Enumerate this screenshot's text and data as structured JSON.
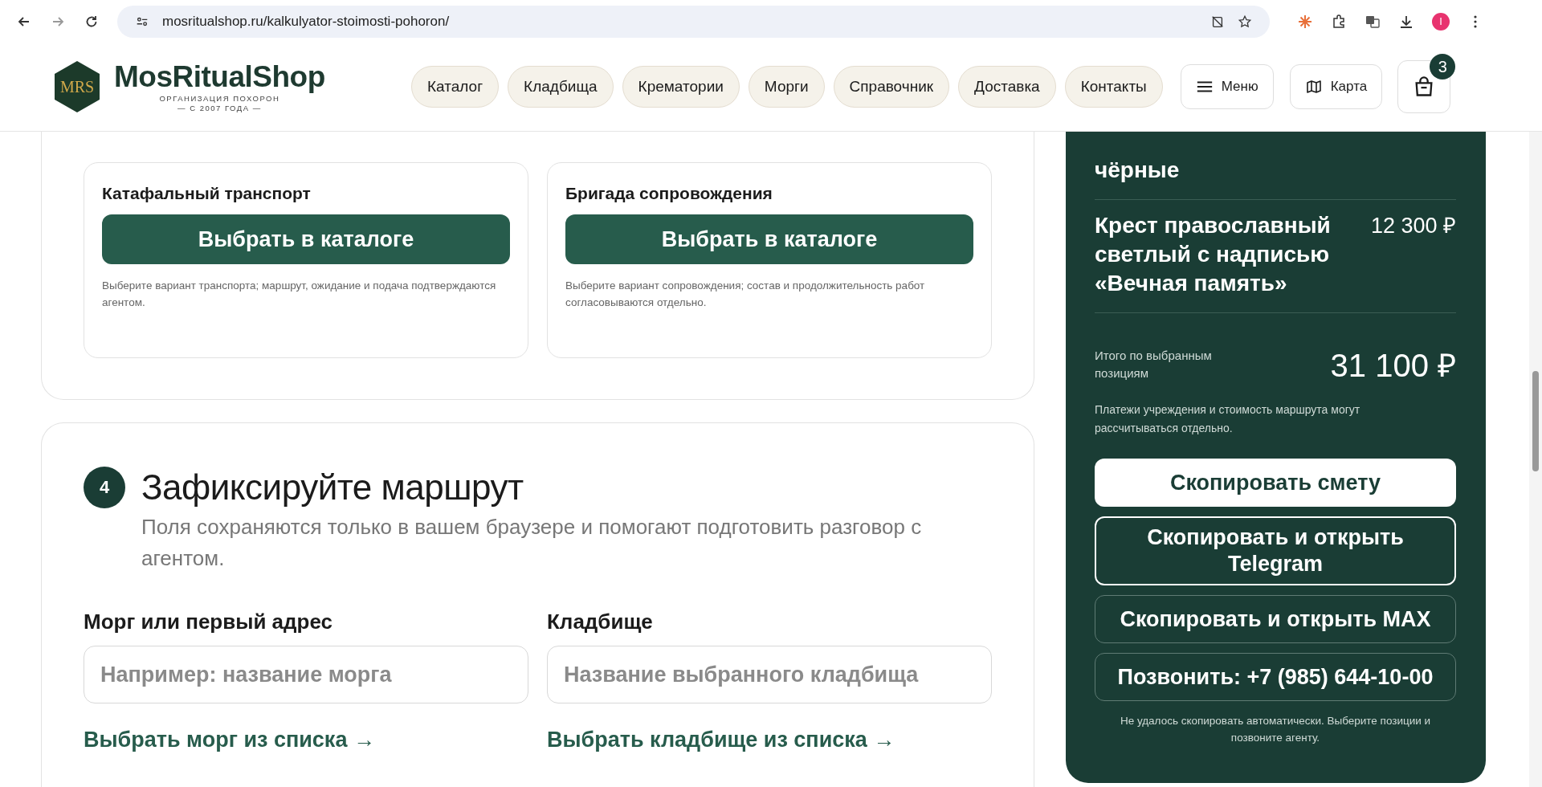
{
  "browser": {
    "url": "mosritualshop.ru/kalkulyator-stoimosti-pohoron/",
    "profile_initial": "I"
  },
  "header": {
    "logo_letters": "MRS",
    "brand": "MosRitualShop",
    "tagline": "ОРГАНИЗАЦИЯ ПОХОРОН",
    "since": "— С 2007 ГОДА —",
    "nav": [
      "Каталог",
      "Кладбища",
      "Крематории",
      "Морги",
      "Справочник",
      "Доставка",
      "Контакты"
    ],
    "menu_button": "Меню",
    "map_button": "Карта",
    "cart_count": "3"
  },
  "services": [
    {
      "title": "Катафальный транспорт",
      "button": "Выбрать в каталоге",
      "note": "Выберите вариант транспорта; маршрут, ожидание и подача подтверждаются агентом."
    },
    {
      "title": "Бригада сопровождения",
      "button": "Выбрать в каталоге",
      "note": "Выберите вариант сопровождения; состав и продолжительность работ согласовываются отдельно."
    }
  ],
  "route_step": {
    "number": "4",
    "title": "Зафиксируйте маршрут",
    "subtitle": "Поля сохраняются только в вашем браузере и помогают подготовить разговор с агентом.",
    "fields": [
      {
        "label": "Морг или первый адрес",
        "placeholder": "Например: название морга",
        "link": "Выбрать морг из списка →"
      },
      {
        "label": "Кладбище",
        "placeholder": "Название выбранного кладбища",
        "link": "Выбрать кладбище из списка →"
      }
    ]
  },
  "summary": {
    "items": [
      {
        "name": "чёрные"
      },
      {
        "name": "Крест православный светлый с надписью «Вечная память»",
        "price": "12 300 ₽"
      }
    ],
    "total_label": "Итого по выбранным позициям",
    "total": "31 100 ₽",
    "note": "Платежи учреждения и стоимость маршрута могут рассчитываться отдельно.",
    "actions": [
      {
        "label": "Скопировать смету",
        "kind": "filled"
      },
      {
        "label": "Скопировать и открыть Telegram",
        "kind": "focused"
      },
      {
        "label": "Скопировать и открыть MAX",
        "kind": "outline"
      },
      {
        "label": "Позвонить: +7 (985) 644-10-00",
        "kind": "outline"
      }
    ],
    "status": "Не удалось скопировать автоматически. Выберите позиции и позвоните агенту."
  }
}
